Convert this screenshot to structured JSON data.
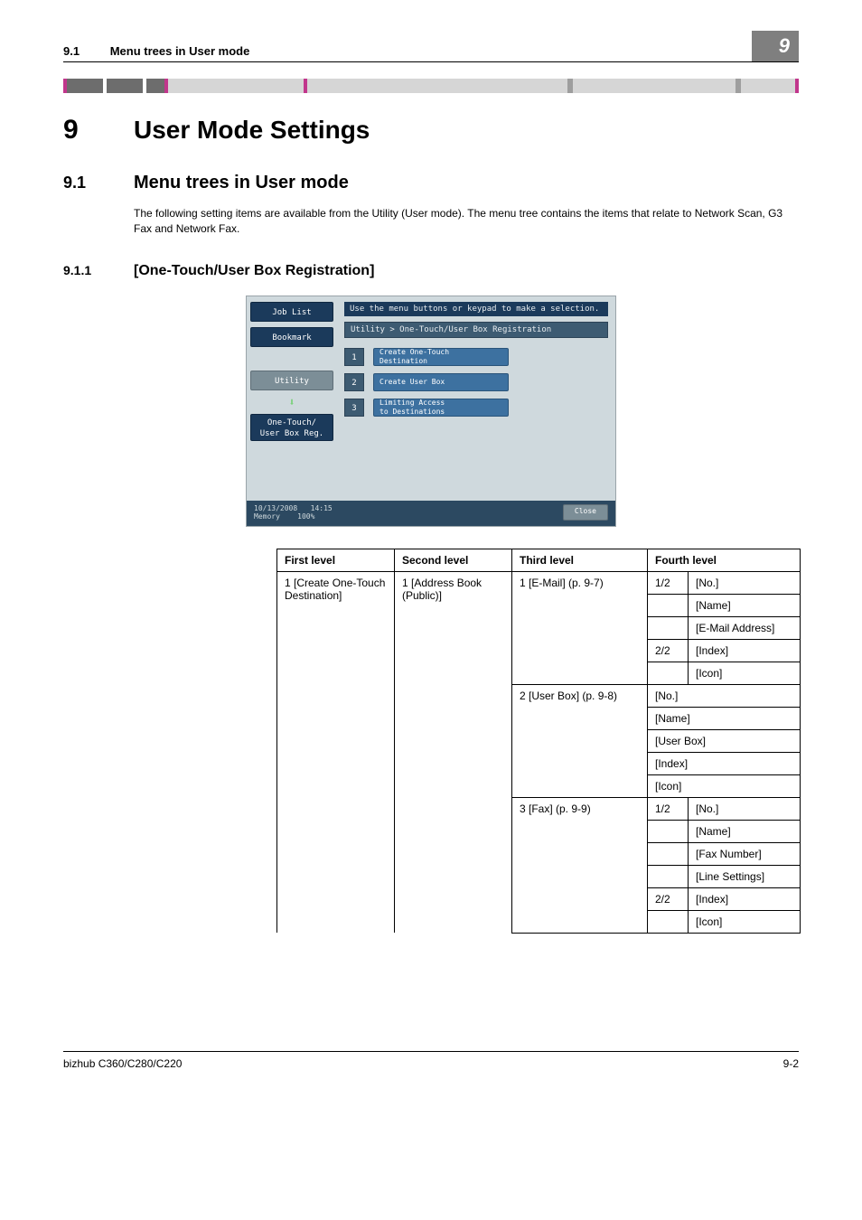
{
  "header": {
    "section_number": "9.1",
    "section_title": "Menu trees in User mode",
    "tab": "9"
  },
  "chapter": {
    "number": "9",
    "title": "User Mode Settings"
  },
  "section": {
    "number": "9.1",
    "title": "Menu trees in User mode",
    "body": "The following setting items are available from the Utility (User mode). The menu tree contains the items that relate to Network Scan, G3 Fax and Network Fax."
  },
  "subsection": {
    "number": "9.1.1",
    "title": "[One-Touch/User Box Registration]"
  },
  "screenshot": {
    "instruction": "Use the menu buttons or keypad to make a selection.",
    "breadcrumb": "Utility > One-Touch/User Box Registration",
    "side": {
      "job_list": "Job List",
      "bookmark": "Bookmark",
      "utility": "Utility",
      "reg": "One-Touch/\nUser Box Reg."
    },
    "menu": [
      {
        "n": "1",
        "label": "Create One-Touch\nDestination"
      },
      {
        "n": "2",
        "label": "Create User Box"
      },
      {
        "n": "3",
        "label": "Limiting Access\nto Destinations"
      }
    ],
    "footer": {
      "date": "10/13/2008",
      "time": "14:15",
      "memory_label": "Memory",
      "memory_val": "100%",
      "close": "Close"
    }
  },
  "table": {
    "headers": [
      "First level",
      "Second level",
      "Third level",
      "Fourth level"
    ],
    "first_level": "1 [Create One-Touch Destination]",
    "second_level": "1 [Address Book (Public)]",
    "groups": [
      {
        "third": "1 [E-Mail] (p. 9-7)",
        "rows": [
          {
            "sub": "1/2",
            "item": "[No.]"
          },
          {
            "sub": "",
            "item": "[Name]"
          },
          {
            "sub": "",
            "item": "[E-Mail Address]"
          },
          {
            "sub": "2/2",
            "item": "[Index]"
          },
          {
            "sub": "",
            "item": "[Icon]"
          }
        ]
      },
      {
        "third": "2 [User Box] (p. 9-8)",
        "rows_full": [
          "[No.]",
          "[Name]",
          "[User Box]",
          "[Index]",
          "[Icon]"
        ]
      },
      {
        "third": "3 [Fax] (p. 9-9)",
        "rows": [
          {
            "sub": "1/2",
            "item": "[No.]"
          },
          {
            "sub": "",
            "item": "[Name]"
          },
          {
            "sub": "",
            "item": "[Fax Number]"
          },
          {
            "sub": "",
            "item": "[Line Settings]"
          },
          {
            "sub": "2/2",
            "item": "[Index]"
          },
          {
            "sub": "",
            "item": "[Icon]"
          }
        ]
      }
    ]
  },
  "footer": {
    "left": "bizhub C360/C280/C220",
    "right": "9-2"
  }
}
